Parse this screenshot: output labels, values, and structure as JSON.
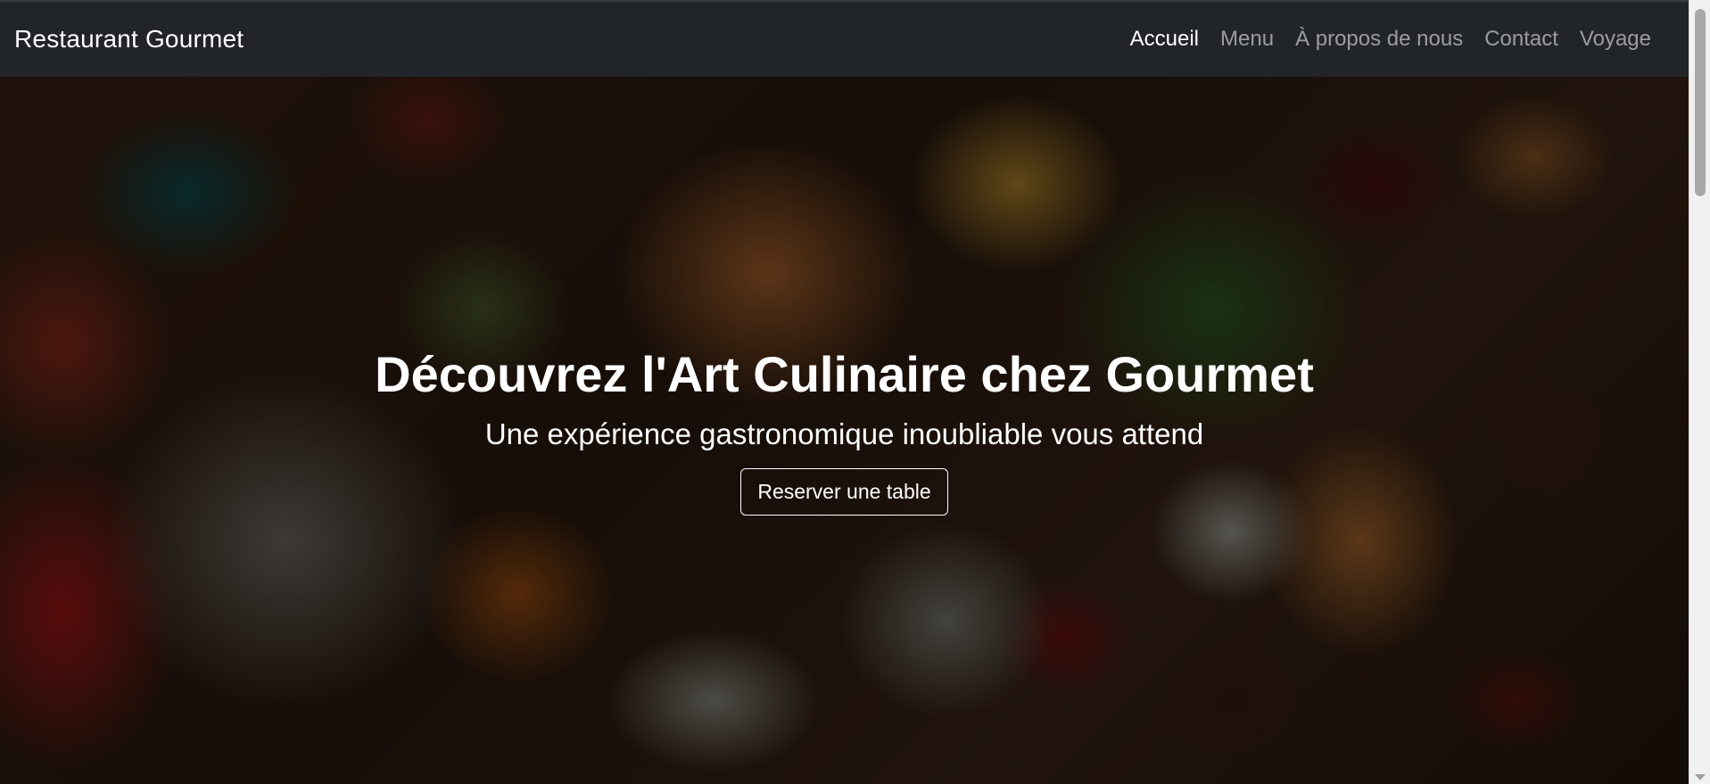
{
  "navbar": {
    "brand": "Restaurant Gourmet",
    "links": [
      {
        "label": "Accueil",
        "active": true
      },
      {
        "label": "Menu",
        "active": false
      },
      {
        "label": "À propos de nous",
        "active": false
      },
      {
        "label": "Contact",
        "active": false
      },
      {
        "label": "Voyage",
        "active": false
      }
    ]
  },
  "hero": {
    "title": "Découvrez l'Art Culinaire chez Gourmet",
    "subtitle": "Une expérience gastronomique inoubliable vous attend",
    "button_label": "Reserver une table"
  },
  "colors": {
    "navbar_bg": "#212529",
    "nav_active": "#ffffff",
    "nav_inactive": "rgba(255,255,255,0.55)"
  }
}
